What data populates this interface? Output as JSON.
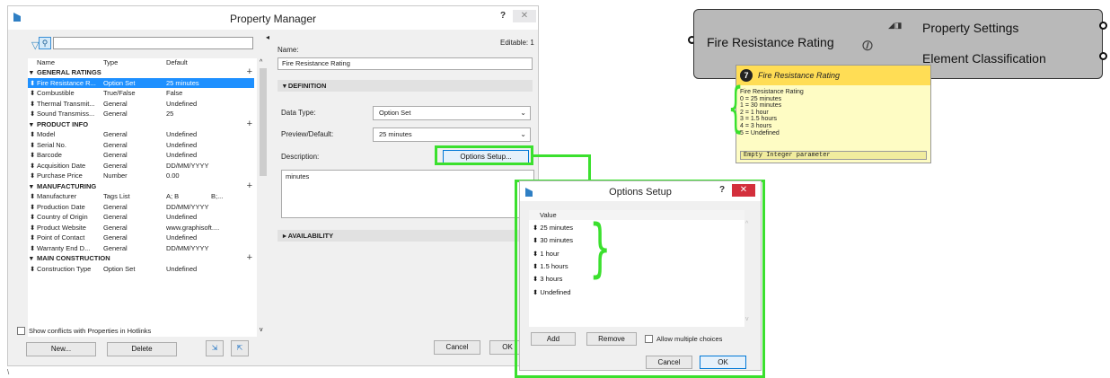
{
  "window": {
    "title": "Property Manager"
  },
  "left": {
    "columns": [
      "Name",
      "Type",
      "Default"
    ],
    "rows": [
      {
        "kind": "group",
        "name": "GENERAL RATINGS"
      },
      {
        "kind": "item",
        "name": "Fire Resistance R...",
        "type": "Option Set",
        "default": "25 minutes",
        "selected": true
      },
      {
        "kind": "item",
        "name": "Combustible",
        "type": "True/False",
        "default": "False"
      },
      {
        "kind": "item",
        "name": "Thermal Transmit...",
        "type": "General",
        "default": "Undefined"
      },
      {
        "kind": "item",
        "name": "Sound Transmiss...",
        "type": "General",
        "default": "25"
      },
      {
        "kind": "group",
        "name": "PRODUCT INFO"
      },
      {
        "kind": "item",
        "name": "Model",
        "type": "General",
        "default": "Undefined"
      },
      {
        "kind": "item",
        "name": "Serial No.",
        "type": "General",
        "default": "Undefined"
      },
      {
        "kind": "item",
        "name": "Barcode",
        "type": "General",
        "default": "Undefined"
      },
      {
        "kind": "item",
        "name": "Acquisition Date",
        "type": "General",
        "default": "DD/MM/YYYY"
      },
      {
        "kind": "item",
        "name": "Purchase Price",
        "type": "Number",
        "default": "0.00"
      },
      {
        "kind": "group",
        "name": "MANUFACTURING"
      },
      {
        "kind": "item",
        "name": "Manufacturer",
        "type": "Tags List",
        "default": "A; B",
        "extra": "B;..."
      },
      {
        "kind": "item",
        "name": "Production Date",
        "type": "General",
        "default": "DD/MM/YYYY"
      },
      {
        "kind": "item",
        "name": "Country of Origin",
        "type": "General",
        "default": "Undefined"
      },
      {
        "kind": "item",
        "name": "Product Website",
        "type": "General",
        "default": "www.graphisoft...."
      },
      {
        "kind": "item",
        "name": "Point of Contact",
        "type": "General",
        "default": "Undefined"
      },
      {
        "kind": "item",
        "name": "Warranty End D...",
        "type": "General",
        "default": "DD/MM/YYYY"
      },
      {
        "kind": "group",
        "name": "MAIN CONSTRUCTION"
      },
      {
        "kind": "item",
        "name": "Construction Type",
        "type": "Option Set",
        "default": "Undefined"
      }
    ],
    "show_conflicts_label": "Show conflicts with Properties in Hotlinks",
    "new_label": "New...",
    "delete_label": "Delete"
  },
  "right": {
    "editable": "Editable: 1",
    "name_label": "Name:",
    "name_value": "Fire Resistance Rating",
    "definition": "DEFINITION",
    "data_type_label": "Data Type:",
    "data_type_value": "Option Set",
    "preview_label": "Preview/Default:",
    "preview_value": "25 minutes",
    "description_label": "Description:",
    "options_setup_button": "Options Setup...",
    "description_value": "minutes",
    "availability": "AVAILABILITY",
    "cancel": "Cancel",
    "ok": "OK"
  },
  "options_dialog": {
    "title": "Options Setup",
    "column": "Value",
    "values": [
      "25 minutes",
      "30 minutes",
      "1 hour",
      "1.5 hours",
      "3 hours",
      "Undefined"
    ],
    "add": "Add",
    "remove": "Remove",
    "allow_multiple": "Allow multiple choices",
    "cancel": "Cancel",
    "ok": "OK"
  },
  "grasshopper": {
    "input_label": "Fire Resistance Rating",
    "output_1": "Property Settings",
    "output_2": "Element Classification",
    "tooltip_number": "7",
    "tooltip_title": "Fire Resistance Rating",
    "tooltip_lines": [
      "Fire Resistance Rating",
      "0 = 25 minutes",
      "1 = 30 minutes",
      "2 = 1 hour",
      "3 = 1.5 hours",
      "4 = 3 hours",
      "5 = Undefined"
    ],
    "tooltip_footer": "Empty Integer parameter"
  },
  "colors": {
    "selection": "#1e90ff",
    "annotation": "#3be02e",
    "close": "#d32f3c",
    "tooltip_head": "#ffdd55"
  },
  "icons": [
    "app-icon",
    "filter-icon",
    "search-icon",
    "close-icon",
    "help-icon",
    "import-icon",
    "export-icon",
    "plus-icon",
    "chevron-down-icon",
    "grasshopper-component-icon"
  ]
}
